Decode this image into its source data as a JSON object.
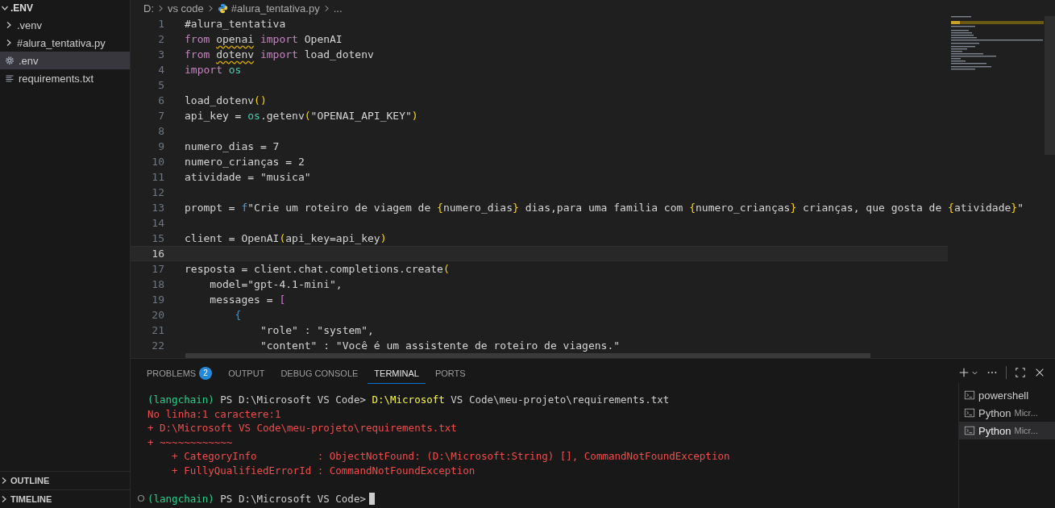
{
  "explorer": {
    "title": ".ENV",
    "expanded": true,
    "items": [
      {
        "label": ".venv",
        "kind": "folder",
        "expanded": false,
        "selected": false
      },
      {
        "label": "#alura_tentativa.py",
        "kind": "folder",
        "expanded": false,
        "selected": false
      },
      {
        "label": ".env",
        "kind": "settings",
        "selected": true
      },
      {
        "label": "requirements.txt",
        "kind": "text",
        "selected": false
      }
    ],
    "sections": [
      {
        "label": "OUTLINE",
        "expanded": false
      },
      {
        "label": "TIMELINE",
        "expanded": false
      }
    ]
  },
  "breadcrumb": [
    "D:",
    "vs code",
    "#alura_tentativa.py",
    "..."
  ],
  "editor": {
    "lines": [
      {
        "number": "1",
        "current": false,
        "tokens": [
          {
            "text": "#alura_tentativa",
            "kind": "plain"
          }
        ]
      },
      {
        "number": "2",
        "current": false,
        "tokens": [
          {
            "text": "from ",
            "kind": "keyword"
          },
          {
            "text": "openai",
            "kind": "warn"
          },
          {
            "text": " import",
            "kind": "keyword"
          },
          {
            "text": " OpenAI",
            "kind": "plain"
          }
        ]
      },
      {
        "number": "3",
        "current": false,
        "tokens": [
          {
            "text": "from ",
            "kind": "keyword"
          },
          {
            "text": "dotenv",
            "kind": "warn"
          },
          {
            "text": " import",
            "kind": "keyword"
          },
          {
            "text": " load_dotenv",
            "kind": "plain"
          }
        ]
      },
      {
        "number": "4",
        "current": false,
        "tokens": [
          {
            "text": "import ",
            "kind": "keyword"
          },
          {
            "text": "os",
            "kind": "module"
          }
        ]
      },
      {
        "number": "5",
        "current": false
      },
      {
        "number": "6",
        "current": false,
        "tokens": [
          {
            "text": "load_dotenv",
            "kind": "plain"
          },
          {
            "text": "()",
            "kind": "brace"
          }
        ]
      },
      {
        "number": "7",
        "current": false,
        "tokens": [
          {
            "text": "api_key = ",
            "kind": "plain"
          },
          {
            "text": "os",
            "kind": "module"
          },
          {
            "text": ".getenv",
            "kind": "plain"
          },
          {
            "text": "(",
            "kind": "brace"
          },
          {
            "text": "\"OPENAI_API_KEY\"",
            "kind": "plain"
          },
          {
            "text": ")",
            "kind": "brace"
          }
        ]
      },
      {
        "number": "8",
        "current": false
      },
      {
        "number": "9",
        "current": false,
        "tokens": [
          {
            "text": "numero_dias = 7",
            "kind": "plain"
          }
        ]
      },
      {
        "number": "10",
        "current": false,
        "tokens": [
          {
            "text": "numero_crianças = 2",
            "kind": "plain"
          }
        ]
      },
      {
        "number": "11",
        "current": false,
        "tokens": [
          {
            "text": "atividade = \"musica\"",
            "kind": "plain"
          }
        ]
      },
      {
        "number": "12",
        "current": false
      },
      {
        "number": "13",
        "current": false,
        "tokens": [
          {
            "text": "prompt = ",
            "kind": "plain"
          },
          {
            "text": "f",
            "kind": "fprefix"
          },
          {
            "text": "\"Crie um roteiro de viagem de ",
            "kind": "plain"
          },
          {
            "text": "{",
            "kind": "brace"
          },
          {
            "text": "numero_dias",
            "kind": "plain"
          },
          {
            "text": "}",
            "kind": "brace"
          },
          {
            "text": " dias,para uma familia com ",
            "kind": "plain"
          },
          {
            "text": "{",
            "kind": "brace"
          },
          {
            "text": "numero_crianças",
            "kind": "plain"
          },
          {
            "text": "}",
            "kind": "brace"
          },
          {
            "text": " crianças, que gosta de ",
            "kind": "plain"
          },
          {
            "text": "{",
            "kind": "brace"
          },
          {
            "text": "atividade",
            "kind": "plain"
          },
          {
            "text": "}",
            "kind": "brace"
          },
          {
            "text": "\"",
            "kind": "plain"
          }
        ]
      },
      {
        "number": "14",
        "current": false
      },
      {
        "number": "15",
        "current": false,
        "tokens": [
          {
            "text": "client = OpenAI",
            "kind": "plain"
          },
          {
            "text": "(",
            "kind": "brace"
          },
          {
            "text": "api_key=api_key",
            "kind": "plain"
          },
          {
            "text": ")",
            "kind": "brace"
          }
        ]
      },
      {
        "number": "16",
        "current": true
      },
      {
        "number": "17",
        "current": false,
        "tokens": [
          {
            "text": "resposta = client.chat.completions.create",
            "kind": "plain"
          },
          {
            "text": "(",
            "kind": "brace"
          }
        ]
      },
      {
        "number": "18",
        "current": false,
        "tokens": [
          {
            "text": "    model=\"gpt-4.1-mini\",",
            "kind": "plain"
          }
        ]
      },
      {
        "number": "19",
        "current": false,
        "tokens": [
          {
            "text": "    messages = ",
            "kind": "plain"
          },
          {
            "text": "[",
            "kind": "bracket"
          }
        ]
      },
      {
        "number": "20",
        "current": false,
        "tokens": [
          {
            "text": "        {",
            "kind": "curly"
          }
        ]
      },
      {
        "number": "21",
        "current": false,
        "tokens": [
          {
            "text": "            \"role\" : \"system\",",
            "kind": "plain"
          }
        ]
      },
      {
        "number": "22",
        "current": false,
        "tokens": [
          {
            "text": "            \"content\" : \"Você é um assistente de roteiro de viagens.\"",
            "kind": "plain"
          }
        ]
      }
    ]
  },
  "panel": {
    "tabs": [
      {
        "label": "PROBLEMS",
        "badge": "2",
        "selected": false
      },
      {
        "label": "OUTPUT",
        "selected": false
      },
      {
        "label": "DEBUG CONSOLE",
        "selected": false
      },
      {
        "label": "TERMINAL",
        "selected": true
      },
      {
        "label": "PORTS",
        "selected": false
      }
    ],
    "terminal": [
      {
        "kind": "prompt",
        "tokens": [
          {
            "text": "(langchain)",
            "kind": "env"
          },
          {
            "text": " PS D:\\Microsoft VS Code> ",
            "kind": "plain"
          },
          {
            "text": "D:\\Microsoft",
            "kind": "command"
          },
          {
            "text": " VS Code\\meu-projeto\\requirements.txt",
            "kind": "plain"
          }
        ]
      },
      {
        "kind": "error",
        "tokens": [
          {
            "text": "No linha:1 caractere:1",
            "kind": "error"
          }
        ]
      },
      {
        "kind": "error",
        "tokens": [
          {
            "text": "+ D:\\Microsoft VS Code\\meu-projeto\\requirements.txt",
            "kind": "error"
          }
        ]
      },
      {
        "kind": "error",
        "tokens": [
          {
            "text": "+ ~~~~~~~~~~~~",
            "kind": "error"
          }
        ]
      },
      {
        "kind": "error",
        "tokens": [
          {
            "text": "    + CategoryInfo          : ObjectNotFound: (D:\\Microsoft:String) [], CommandNotFoundException",
            "kind": "error"
          }
        ]
      },
      {
        "kind": "error",
        "tokens": [
          {
            "text": "    + FullyQualifiedErrorId : CommandNotFoundException",
            "kind": "error"
          }
        ]
      },
      {
        "kind": "blank"
      },
      {
        "kind": "current",
        "tokens": [
          {
            "text": "(langchain)",
            "kind": "env"
          },
          {
            "text": " PS D:\\Microsoft VS Code>",
            "kind": "plain"
          }
        ]
      }
    ],
    "terminals": [
      {
        "name": "powershell",
        "selected": false
      },
      {
        "name": "Python",
        "detail": "Micr...",
        "selected": false
      },
      {
        "name": "Python",
        "detail": "Micr...",
        "selected": true
      }
    ]
  }
}
